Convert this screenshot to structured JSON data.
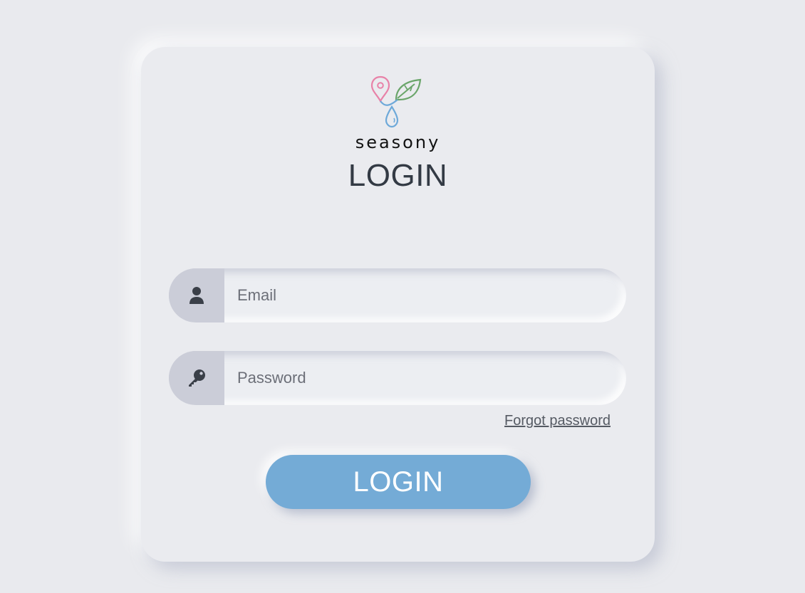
{
  "brand": {
    "name": "seasony",
    "logo_icon": "seasony-logo-icon",
    "colors": {
      "pin": "#e882a8",
      "leaf": "#6aa56a",
      "drop": "#6ea9d9"
    }
  },
  "page": {
    "title": "LOGIN"
  },
  "form": {
    "email": {
      "placeholder": "Email",
      "value": "",
      "icon": "user-icon"
    },
    "password": {
      "placeholder": "Password",
      "value": "",
      "icon": "key-icon"
    },
    "forgot_label": "Forgot password",
    "submit_label": "LOGIN"
  },
  "colors": {
    "background": "#e9eaee",
    "accent": "#74abd6",
    "icon_box": "#cbcdd8",
    "text_dark": "#333a44"
  }
}
